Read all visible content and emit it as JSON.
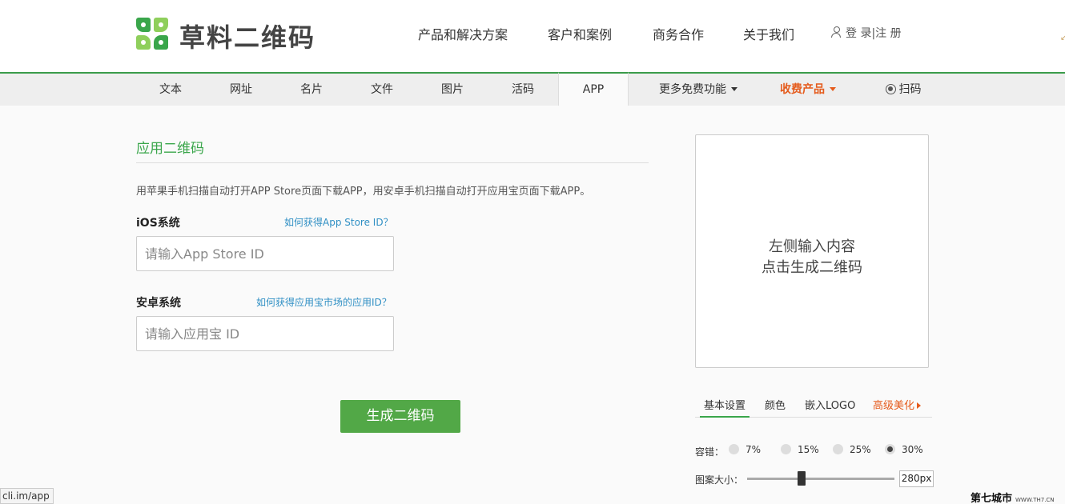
{
  "header": {
    "logo_text": "草料二维码",
    "nav": [
      "产品和解决方案",
      "客户和案例",
      "商务合作",
      "关于我们"
    ],
    "login": "登 录|注 册"
  },
  "subnav": {
    "tabs": [
      "文本",
      "网址",
      "名片",
      "文件",
      "图片",
      "活码",
      "APP",
      "更多免费功能",
      "收费产品",
      "扫码"
    ],
    "active": "APP"
  },
  "form": {
    "title": "应用二维码",
    "description": "用苹果手机扫描自动打开APP Store页面下载APP，用安卓手机扫描自动打开应用宝页面下载APP。",
    "ios_label": "iOS系统",
    "ios_help": "如何获得App Store ID？",
    "ios_placeholder": "请输入App Store ID",
    "android_label": "安卓系统",
    "android_help": "如何获得应用宝市场的应用ID？",
    "android_placeholder": "请输入应用宝 ID",
    "generate_button": "生成二维码"
  },
  "preview": {
    "line1": "左侧输入内容",
    "line2": "点击生成二维码"
  },
  "settings": {
    "tabs": [
      "基本设置",
      "颜色",
      "嵌入LOGO",
      "高级美化"
    ],
    "active_tab": "基本设置",
    "error_label": "容错：",
    "error_options": [
      "7%",
      "15%",
      "25%",
      "30%"
    ],
    "error_selected": "30%",
    "size_label": "图案大小：",
    "size_value": "280px",
    "size_slider_fraction": 0.37
  },
  "status_url": "cli.im/app",
  "watermark": "第七城市",
  "watermark_small": "WWW.TH7.CN",
  "colors": {
    "brand_green": "#3aa64b",
    "button_green": "#52a847",
    "paid_orange": "#e55b1c",
    "link_blue": "#2f8fc4"
  }
}
